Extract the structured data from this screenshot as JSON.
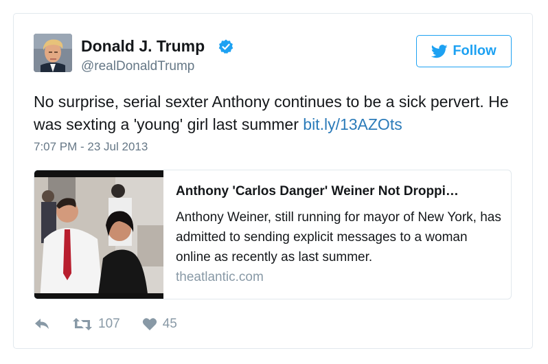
{
  "author": {
    "name": "Donald J. Trump",
    "handle": "@realDonaldTrump",
    "verified": true,
    "verified_icon": "verified-badge-icon"
  },
  "follow_button": {
    "label": "Follow",
    "icon": "twitter-bird-icon"
  },
  "tweet": {
    "text_before_link": "No surprise, serial sexter Anthony continues to be a sick pervert. He was sexting a 'young' girl last summer ",
    "link_text": "bit.ly/13AZOts",
    "timestamp": "7:07 PM - 23 Jul 2013"
  },
  "link_card": {
    "title": "Anthony 'Carlos Danger' Weiner Not Droppi…",
    "description": "Anthony Weiner, still running for mayor of New York, has admitted to sending explicit messages to a woman online as recently as last summer.",
    "domain": "theatlantic.com"
  },
  "actions": {
    "reply_icon": "reply-icon",
    "retweet_icon": "retweet-icon",
    "retweet_count": "107",
    "like_icon": "heart-icon",
    "like_count": "45"
  },
  "colors": {
    "accent": "#1da1f2",
    "link": "#2b7bb9",
    "muted": "#657786",
    "border": "#e1e8ed",
    "action": "#8899a6"
  }
}
